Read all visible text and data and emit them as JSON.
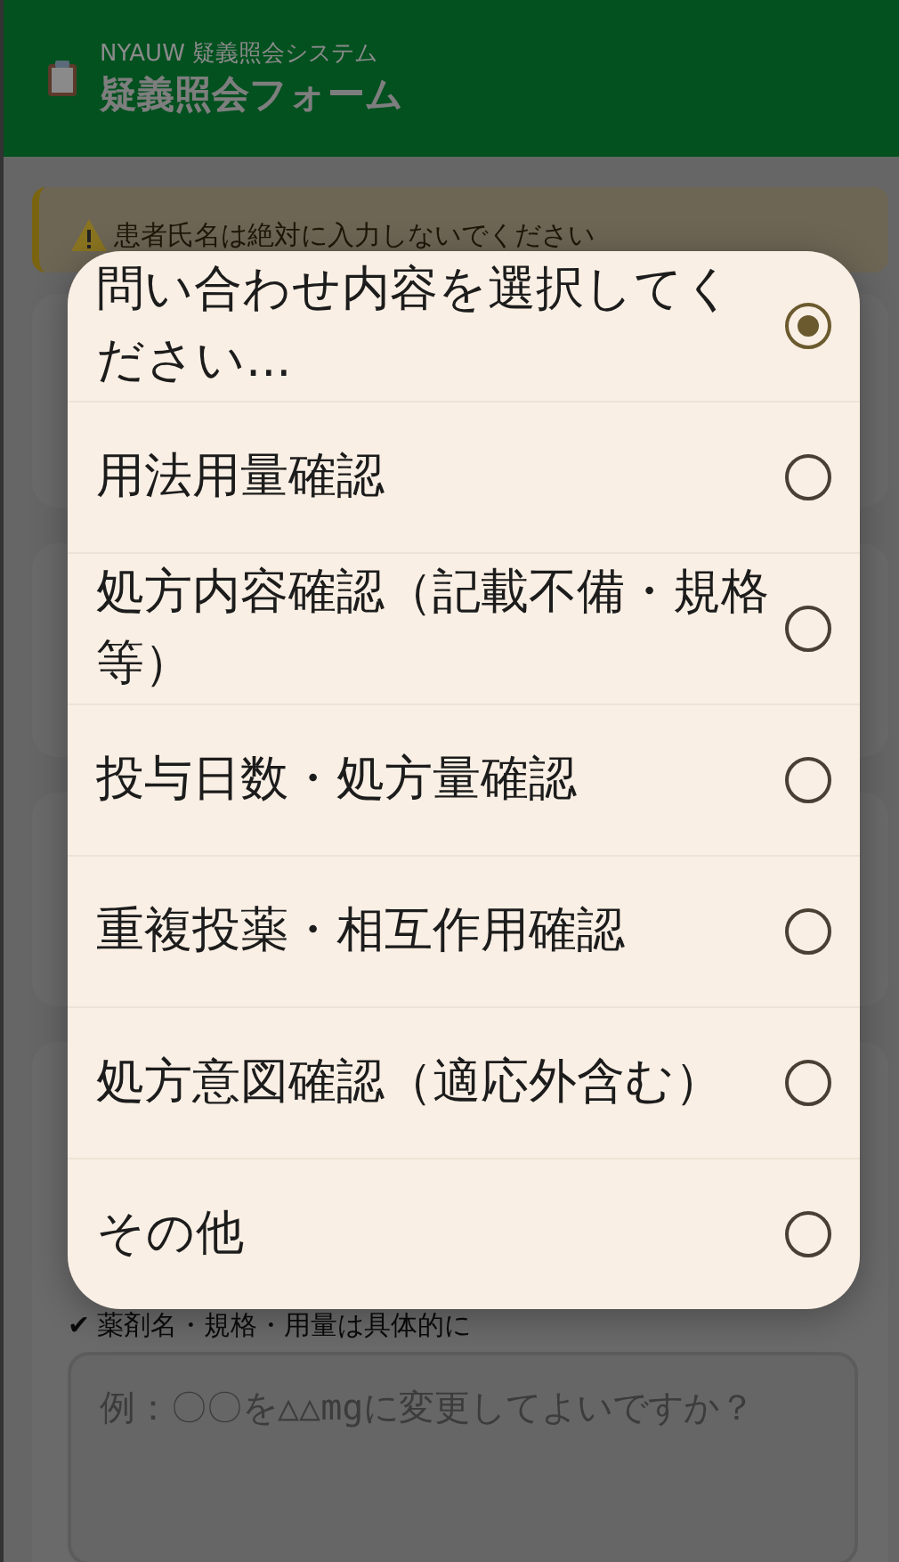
{
  "header": {
    "subtitle": "NYAUW 疑義照会システム",
    "title": "疑義照会フォーム"
  },
  "warning": {
    "text": "患者氏名は絶対に入力しないでください"
  },
  "hint": {
    "mark": "✔",
    "text": "薬剤名・規格・用量は具体的に"
  },
  "question_field": {
    "placeholder": "例：〇〇を△△mgに変更してよいですか？"
  },
  "dialog": {
    "options": [
      {
        "label": "問い合わせ内容を選択してください...",
        "selected": true
      },
      {
        "label": "用法用量確認",
        "selected": false
      },
      {
        "label": "処方内容確認（記載不備・規格等）",
        "selected": false
      },
      {
        "label": "投与日数・処方量確認",
        "selected": false
      },
      {
        "label": "重複投薬・相互作用確認",
        "selected": false
      },
      {
        "label": "処方意図確認（適応外含む）",
        "selected": false
      },
      {
        "label": "その他",
        "selected": false
      }
    ]
  }
}
